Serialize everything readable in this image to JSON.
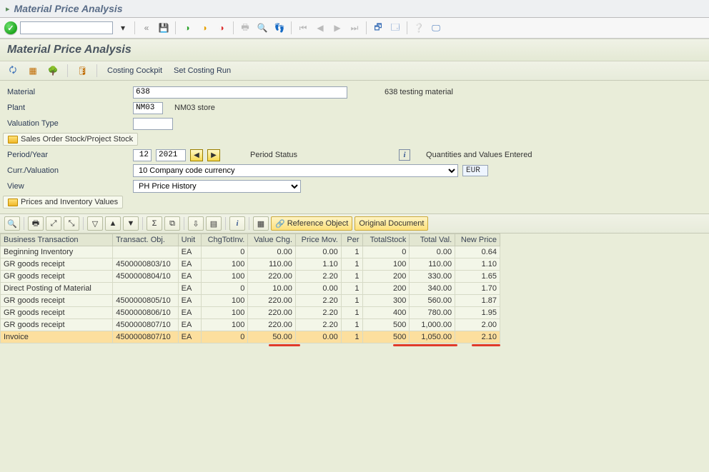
{
  "window": {
    "title": "Material Price Analysis"
  },
  "section": {
    "title": "Material Price Analysis"
  },
  "subtoolbar": {
    "costing_cockpit": "Costing Cockpit",
    "set_costing_run": "Set Costing Run"
  },
  "form": {
    "material_label": "Material",
    "material_value": "638",
    "material_desc": "638 testing material",
    "plant_label": "Plant",
    "plant_value": "NM03",
    "plant_desc": "NM03 store",
    "valtype_label": "Valuation Type",
    "valtype_value": "",
    "stock_toggle": "Sales Order Stock/Project Stock",
    "period_label": "Period/Year",
    "period_value": "12",
    "year_value": "2021",
    "period_status_label": "Period Status",
    "period_status_desc": "Quantities and Values Entered",
    "curr_label": "Curr./Valuation",
    "curr_value": "10 Company code currency",
    "curr_unit": "EUR",
    "view_label": "View",
    "view_value": "PH Price History",
    "prices_toggle": "Prices and Inventory Values"
  },
  "table_toolbar": {
    "reference": "Reference Object",
    "original_doc": "Original Document"
  },
  "columns": {
    "biztrans": "Business Transaction",
    "transobj": "Transact. Obj.",
    "unit": "Unit",
    "chgtotinv": "ChgTotInv.",
    "valuechg": "Value Chg.",
    "pricemov": "Price Mov.",
    "per": "Per",
    "totalstock": "TotalStock",
    "totalval": "Total Val.",
    "newprice": "New Price"
  },
  "rows": [
    {
      "biztrans": "Beginning Inventory",
      "transobj": "",
      "unit": "EA",
      "chgtotinv": "0",
      "valuechg": "0.00",
      "pricemov": "0.00",
      "per": "1",
      "totalstock": "0",
      "totalval": "0.00",
      "newprice": "0.64"
    },
    {
      "biztrans": "GR goods receipt",
      "transobj": "4500000803/10",
      "unit": "EA",
      "chgtotinv": "100",
      "valuechg": "110.00",
      "pricemov": "1.10",
      "per": "1",
      "totalstock": "100",
      "totalval": "110.00",
      "newprice": "1.10"
    },
    {
      "biztrans": "GR goods receipt",
      "transobj": "4500000804/10",
      "unit": "EA",
      "chgtotinv": "100",
      "valuechg": "220.00",
      "pricemov": "2.20",
      "per": "1",
      "totalstock": "200",
      "totalval": "330.00",
      "newprice": "1.65"
    },
    {
      "biztrans": "Direct Posting of Material",
      "transobj": "",
      "unit": "EA",
      "chgtotinv": "0",
      "valuechg": "10.00",
      "pricemov": "0.00",
      "per": "1",
      "totalstock": "200",
      "totalval": "340.00",
      "newprice": "1.70"
    },
    {
      "biztrans": "GR goods receipt",
      "transobj": "4500000805/10",
      "unit": "EA",
      "chgtotinv": "100",
      "valuechg": "220.00",
      "pricemov": "2.20",
      "per": "1",
      "totalstock": "300",
      "totalval": "560.00",
      "newprice": "1.87"
    },
    {
      "biztrans": "GR goods receipt",
      "transobj": "4500000806/10",
      "unit": "EA",
      "chgtotinv": "100",
      "valuechg": "220.00",
      "pricemov": "2.20",
      "per": "1",
      "totalstock": "400",
      "totalval": "780.00",
      "newprice": "1.95"
    },
    {
      "biztrans": "GR goods receipt",
      "transobj": "4500000807/10",
      "unit": "EA",
      "chgtotinv": "100",
      "valuechg": "220.00",
      "pricemov": "2.20",
      "per": "1",
      "totalstock": "500",
      "totalval": "1,000.00",
      "newprice": "2.00"
    },
    {
      "biztrans": "Invoice",
      "transobj": "4500000807/10",
      "unit": "EA",
      "chgtotinv": "0",
      "valuechg": "50.00",
      "pricemov": "0.00",
      "per": "1",
      "totalstock": "500",
      "totalval": "1,050.00",
      "newprice": "2.10",
      "highlight": true
    }
  ],
  "colors": {
    "highlight_row": "#fcdf9e",
    "annotation": "#e13a2a"
  }
}
